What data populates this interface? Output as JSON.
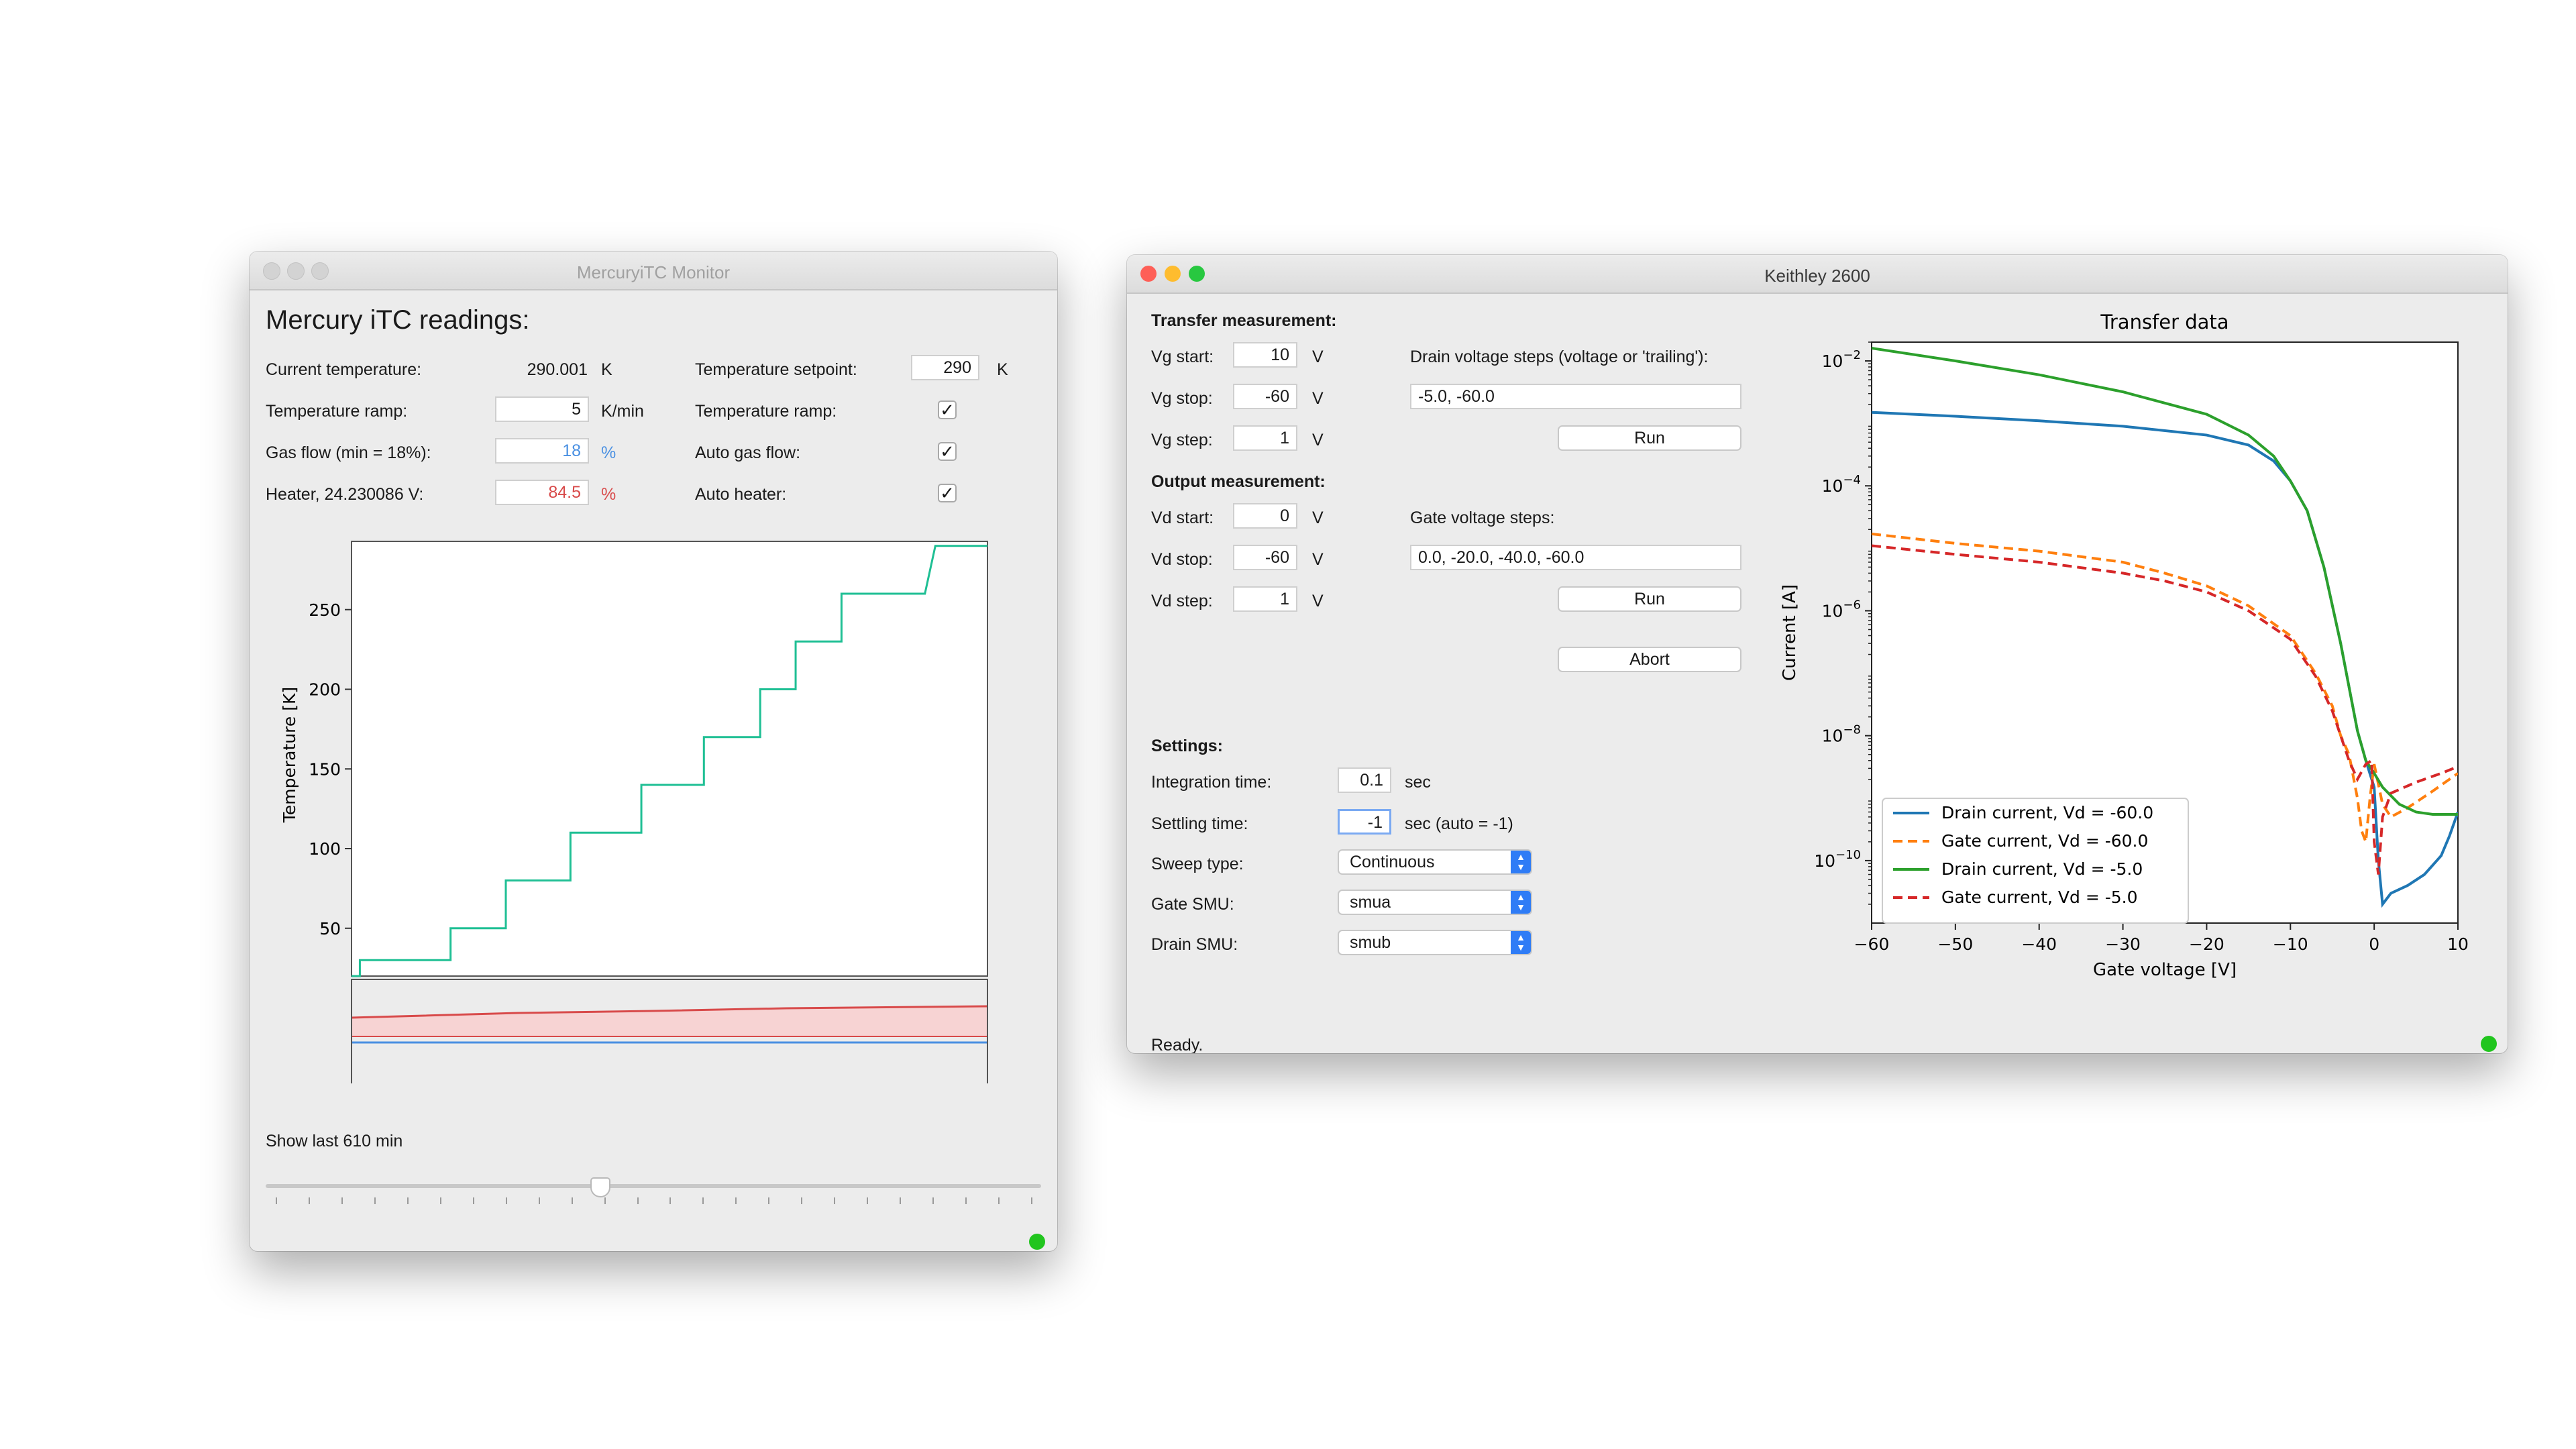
{
  "mercury": {
    "window_title": "MercuryiTC Monitor",
    "heading": "Mercury iTC readings:",
    "current_temp_label": "Current temperature:",
    "current_temp_value": "290.001",
    "current_temp_unit": "K",
    "ramp_label": "Temperature ramp:",
    "ramp_value": "5",
    "ramp_unit": "K/min",
    "gas_label": "Gas flow (min = 18%):",
    "gas_value": "18",
    "gas_unit": "%",
    "heater_label": "Heater, 24.230086 V:",
    "heater_value": "84.5",
    "heater_unit": "%",
    "setpoint_label": "Temperature setpoint:",
    "setpoint_value": "290",
    "setpoint_unit": "K",
    "ramp_enable_label": "Temperature ramp:",
    "ramp_enable_checked": true,
    "auto_gas_label": "Auto gas flow:",
    "auto_gas_checked": true,
    "auto_heater_label": "Auto heater:",
    "auto_heater_checked": true,
    "show_last_label": "Show last 610 min",
    "slider_level": 0.43,
    "colors": {
      "temp": "#1fbf94",
      "heater": "#d84a4a",
      "heater_fill": "#f7d3d3",
      "gas": "#4a90e2"
    }
  },
  "keithley": {
    "window_title": "Keithley 2600",
    "transfer_header": "Transfer measurement:",
    "vg_start_label": "Vg start:",
    "vg_start_value": "10",
    "vg_stop_label": "Vg stop:",
    "vg_stop_value": "-60",
    "vg_step_label": "Vg step:",
    "vg_step_value": "1",
    "unit_v": "V",
    "drain_steps_label": "Drain voltage steps (voltage or 'trailing'):",
    "drain_steps_value": "-5.0, -60.0",
    "run_label": "Run",
    "output_header": "Output measurement:",
    "vd_start_label": "Vd start:",
    "vd_start_value": "0",
    "vd_stop_label": "Vd stop:",
    "vd_stop_value": "-60",
    "vd_step_label": "Vd step:",
    "vd_step_value": "1",
    "gate_steps_label": "Gate voltage steps:",
    "gate_steps_value": "0.0, -20.0, -40.0, -60.0",
    "abort_label": "Abort",
    "settings_header": "Settings:",
    "integration_label": "Integration time:",
    "integration_value": "0.1",
    "integration_unit": "sec",
    "settling_label": "Settling time:",
    "settling_value": "-1",
    "settling_unit": "sec (auto = -1)",
    "sweep_label": "Sweep type:",
    "sweep_value": "Continuous",
    "gate_smu_label": "Gate SMU:",
    "gate_smu_value": "smua",
    "drain_smu_label": "Drain SMU:",
    "drain_smu_value": "smub",
    "status": "Ready."
  },
  "chart_data": [
    {
      "type": "line",
      "ylabel": "Temperature [K]",
      "yticks": [
        50,
        100,
        150,
        200,
        250
      ],
      "ylim": [
        20,
        292
      ],
      "x_units": "min",
      "xlim": [
        0,
        610
      ],
      "series": [
        {
          "color": "#1fbf94",
          "points": [
            [
              0,
              20
            ],
            [
              8,
              20
            ],
            [
              8,
              30
            ],
            [
              95,
              30
            ],
            [
              95,
              50
            ],
            [
              148,
              50
            ],
            [
              148,
              80
            ],
            [
              210,
              80
            ],
            [
              210,
              110
            ],
            [
              278,
              110
            ],
            [
              278,
              140
            ],
            [
              338,
              140
            ],
            [
              338,
              170
            ],
            [
              392,
              170
            ],
            [
              392,
              200
            ],
            [
              426,
              200
            ],
            [
              426,
              230
            ],
            [
              470,
              230
            ],
            [
              470,
              260
            ],
            [
              550,
              260
            ],
            [
              560,
              290
            ],
            [
              610,
              290
            ]
          ]
        }
      ]
    },
    {
      "type": "line",
      "title": "Transfer data",
      "xlabel": "Gate voltage [V]",
      "ylabel": "Current [A]",
      "xlim": [
        -60,
        10
      ],
      "ylim": [
        1e-11,
        0.02
      ],
      "yscale": "log",
      "xticks": [
        -60,
        -50,
        -40,
        -30,
        -20,
        -10,
        0,
        10
      ],
      "ytick_exponents": [
        -2,
        -4,
        -6,
        -8,
        -10
      ],
      "grid": false,
      "legend_position": "lower-left",
      "series": [
        {
          "name": "Drain current, Vd = -60.0",
          "color": "#1f77b4",
          "dash": false,
          "points": [
            [
              -60,
              0.0015
            ],
            [
              -50,
              0.0013
            ],
            [
              -40,
              0.0011
            ],
            [
              -30,
              0.0009
            ],
            [
              -20,
              0.00065
            ],
            [
              -15,
              0.00045
            ],
            [
              -12,
              0.00025
            ],
            [
              -10,
              0.00012
            ],
            [
              -8,
              4e-05
            ],
            [
              -6,
              5e-06
            ],
            [
              -4,
              3e-07
            ],
            [
              -2,
              1.2e-08
            ],
            [
              -1,
              4e-09
            ],
            [
              0,
              1.5e-09
            ],
            [
              0.5,
              1e-10
            ],
            [
              1,
              2e-11
            ],
            [
              2,
              3e-11
            ],
            [
              4,
              4e-11
            ],
            [
              6,
              6e-11
            ],
            [
              8,
              1.2e-10
            ],
            [
              9,
              2.5e-10
            ],
            [
              10,
              6e-10
            ]
          ]
        },
        {
          "name": "Gate current, Vd = -60.0",
          "color": "#ff7f0e",
          "dash": true,
          "points": [
            [
              -60,
              1.7e-05
            ],
            [
              -50,
              1.2e-05
            ],
            [
              -40,
              9e-06
            ],
            [
              -30,
              6e-06
            ],
            [
              -25,
              4e-06
            ],
            [
              -20,
              2.5e-06
            ],
            [
              -15,
              1.2e-06
            ],
            [
              -10,
              4e-07
            ],
            [
              -7,
              1e-07
            ],
            [
              -5,
              3e-08
            ],
            [
              -4,
              1e-08
            ],
            [
              -3,
              5e-09
            ],
            [
              -2,
              1e-09
            ],
            [
              -1.5,
              3e-10
            ],
            [
              -1,
              2e-10
            ],
            [
              -0.5,
              1e-09
            ],
            [
              0,
              3.5e-09
            ],
            [
              1,
              8e-10
            ],
            [
              2,
              5e-10
            ],
            [
              4,
              7e-10
            ],
            [
              7,
              1.3e-09
            ],
            [
              10,
              2.5e-09
            ]
          ]
        },
        {
          "name": "Drain current, Vd = -5.0",
          "color": "#2ca02c",
          "dash": false,
          "points": [
            [
              -60,
              0.016
            ],
            [
              -50,
              0.01
            ],
            [
              -40,
              0.006
            ],
            [
              -30,
              0.0032
            ],
            [
              -20,
              0.0014
            ],
            [
              -15,
              0.00065
            ],
            [
              -12,
              0.0003
            ],
            [
              -10,
              0.00012
            ],
            [
              -8,
              4e-05
            ],
            [
              -6,
              5e-06
            ],
            [
              -4,
              3e-07
            ],
            [
              -2,
              1.2e-08
            ],
            [
              -1,
              4e-09
            ],
            [
              0,
              2.5e-09
            ],
            [
              1,
              1.5e-09
            ],
            [
              3,
              8e-10
            ],
            [
              5,
              6e-10
            ],
            [
              7,
              5.5e-10
            ],
            [
              10,
              5.5e-10
            ]
          ]
        },
        {
          "name": "Gate current, Vd = -5.0",
          "color": "#d62728",
          "dash": true,
          "points": [
            [
              -60,
              1.1e-05
            ],
            [
              -50,
              8e-06
            ],
            [
              -40,
              6e-06
            ],
            [
              -30,
              4e-06
            ],
            [
              -25,
              3e-06
            ],
            [
              -20,
              2e-06
            ],
            [
              -15,
              1e-06
            ],
            [
              -10,
              3.5e-07
            ],
            [
              -7,
              9e-08
            ],
            [
              -5,
              2.5e-08
            ],
            [
              -4,
              1e-08
            ],
            [
              -3,
              4e-09
            ],
            [
              -2,
              2e-09
            ],
            [
              -1,
              3.5e-09
            ],
            [
              -0.3,
              4e-09
            ],
            [
              0,
              2e-10
            ],
            [
              0.5,
              6e-11
            ],
            [
              1,
              5e-10
            ],
            [
              2,
              1.2e-09
            ],
            [
              5,
              1.8e-09
            ],
            [
              8,
              2.5e-09
            ],
            [
              10,
              3.2e-09
            ]
          ]
        }
      ]
    }
  ]
}
